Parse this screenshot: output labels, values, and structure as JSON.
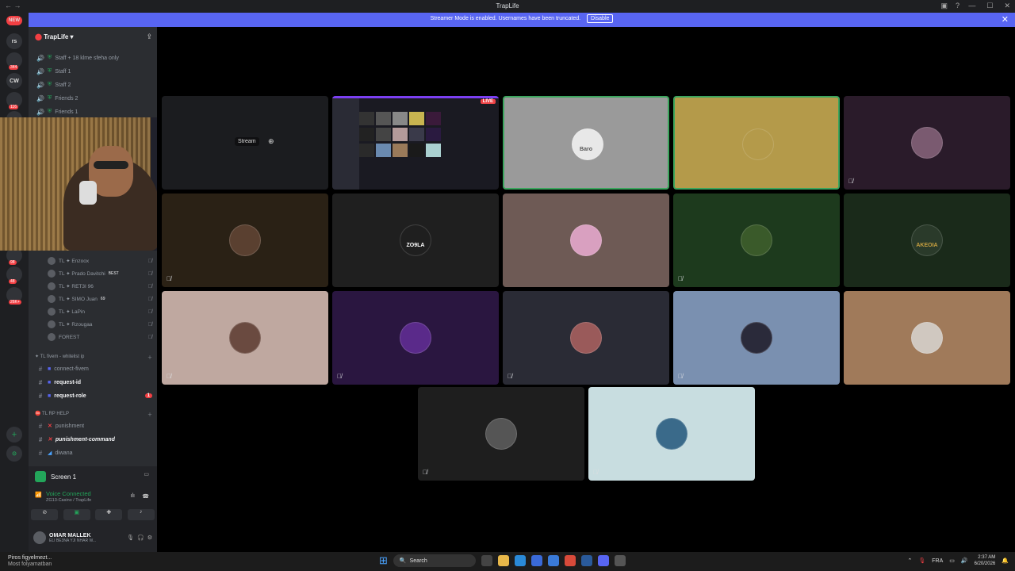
{
  "window": {
    "title": "TrapLife"
  },
  "banner": {
    "message": "Streamer Mode is enabled. Usernames have been truncated.",
    "disable_label": "Disable"
  },
  "server": {
    "name": "TrapLife"
  },
  "servers": {
    "items": [
      {
        "label": "NEW",
        "badge": ""
      },
      {
        "label": "rs",
        "badge": ""
      },
      {
        "label": "",
        "badge": "344"
      },
      {
        "label": "CW",
        "badge": ""
      },
      {
        "label": "",
        "badge": "116"
      },
      {
        "label": "",
        "badge": ""
      },
      {
        "label": "",
        "badge": "116"
      },
      {
        "label": "ZAN",
        "badge": "306"
      },
      {
        "label": "",
        "badge": "44"
      },
      {
        "label": "",
        "badge": ""
      },
      {
        "label": "",
        "badge": "385"
      },
      {
        "label": "2",
        "badge": ""
      },
      {
        "label": "",
        "badge": "98"
      },
      {
        "label": "",
        "badge": "48"
      },
      {
        "label": "",
        "badge": "26K+"
      }
    ]
  },
  "channels_top": [
    {
      "icon": "speaker-icon",
      "label": "Staff + 18 klme sfeha only"
    },
    {
      "icon": "speaker-icon",
      "label": "Staff 1"
    },
    {
      "icon": "speaker-icon",
      "label": "Staff 2"
    },
    {
      "icon": "speaker-icon",
      "label": "Friends 2"
    },
    {
      "icon": "speaker-icon",
      "label": "Friends 1"
    }
  ],
  "voice_users": [
    {
      "name": "TL ✦ Enzoox",
      "tag": ""
    },
    {
      "name": "TL ✦ Prado Davitchi",
      "tag": "BEST"
    },
    {
      "name": "TL ✦ RET3I 96",
      "tag": ""
    },
    {
      "name": "TL ✦ SIMO Juan",
      "tag": "69"
    },
    {
      "name": "TL ✦ LaPin",
      "tag": ""
    },
    {
      "name": "TL ✦ Rzougaa",
      "tag": ""
    },
    {
      "name": "FOREST",
      "tag": ""
    }
  ],
  "category_fivem": {
    "label": "TL fivem - whitelist ip"
  },
  "channels_fivem": [
    {
      "label": "connect-fivem",
      "bright": false,
      "badge": ""
    },
    {
      "label": "request-id",
      "bright": true,
      "badge": ""
    },
    {
      "label": "request-role",
      "bright": true,
      "badge": "1"
    }
  ],
  "category_help": {
    "label": "TL RP HELP"
  },
  "channels_help": [
    {
      "label": "punishment",
      "bright": false
    },
    {
      "label": "punishment-command",
      "bright": true
    },
    {
      "label": "diwana",
      "bright": false
    }
  ],
  "voice_panel": {
    "screen_label": "Screen 1",
    "status": "Voice Connected",
    "location": "ZG13-Casino / TrapLife",
    "username": "OMAR MALLEK",
    "user_status": "ELI BE3NA YJI NHAR W..."
  },
  "stage": {
    "stream_label": "Stream",
    "live_label": "LIVE",
    "tiles": [
      {
        "bg": "#1b1c1f",
        "avatar_color": "#1b1c1f",
        "muted": false,
        "speaking": false,
        "type": "stream"
      },
      {
        "bg": "#1a1a22",
        "avatar_color": "#1a1a22",
        "muted": false,
        "speaking": false,
        "type": "screen"
      },
      {
        "bg": "#9a9a9a",
        "avatar_color": "#e8e8e8",
        "muted": false,
        "speaking": true,
        "type": "user"
      },
      {
        "bg": "#b49a4a",
        "avatar_color": "#b49a4a",
        "muted": false,
        "speaking": true,
        "type": "user"
      },
      {
        "bg": "#2a1b2a",
        "avatar_color": "#7a5a70",
        "muted": true,
        "speaking": false,
        "type": "user"
      },
      {
        "bg": "#2a2115",
        "avatar_color": "#5a4030",
        "muted": true,
        "speaking": false,
        "type": "user"
      },
      {
        "bg": "#1f1f1f",
        "avatar_color": "#1f1f1f",
        "muted": false,
        "speaking": false,
        "type": "user"
      },
      {
        "bg": "#6e5a55",
        "avatar_color": "#d9a0c0",
        "muted": false,
        "speaking": false,
        "type": "user"
      },
      {
        "bg": "#1d3a1d",
        "avatar_color": "#3a5a2a",
        "muted": true,
        "speaking": false,
        "type": "user"
      },
      {
        "bg": "#1a2a1a",
        "avatar_color": "#2a3a2a",
        "muted": false,
        "speaking": false,
        "type": "user"
      },
      {
        "bg": "#bfa8a0",
        "avatar_color": "#6a4a40",
        "muted": true,
        "speaking": false,
        "type": "user"
      },
      {
        "bg": "#2a1640",
        "avatar_color": "#5a2a8a",
        "muted": true,
        "speaking": false,
        "type": "user"
      },
      {
        "bg": "#2a2b35",
        "avatar_color": "#9a5a5a",
        "muted": true,
        "speaking": false,
        "type": "user"
      },
      {
        "bg": "#7a90b0",
        "avatar_color": "#2a2a3a",
        "muted": true,
        "speaking": false,
        "type": "user"
      },
      {
        "bg": "#a07a5a",
        "avatar_color": "#d0c8c0",
        "muted": false,
        "speaking": false,
        "type": "user"
      },
      {
        "bg": "#1e1e1e",
        "avatar_color": "#555555",
        "muted": true,
        "speaking": false,
        "type": "user"
      },
      {
        "bg": "#c8dde0",
        "avatar_color": "#3a6a8a",
        "muted": true,
        "speaking": false,
        "type": "user"
      }
    ],
    "tile_texts": {
      "zo9la": "ZO9LA",
      "akeoia": "AKEOIA",
      "baro": "Baro"
    }
  },
  "taskbar": {
    "weather_line1": "Piros figyelmezt...",
    "weather_line2": "Most folyamatban",
    "search_placeholder": "Search",
    "lang": "FRA",
    "time": "2:37 AM",
    "date": "6/20/2026"
  }
}
